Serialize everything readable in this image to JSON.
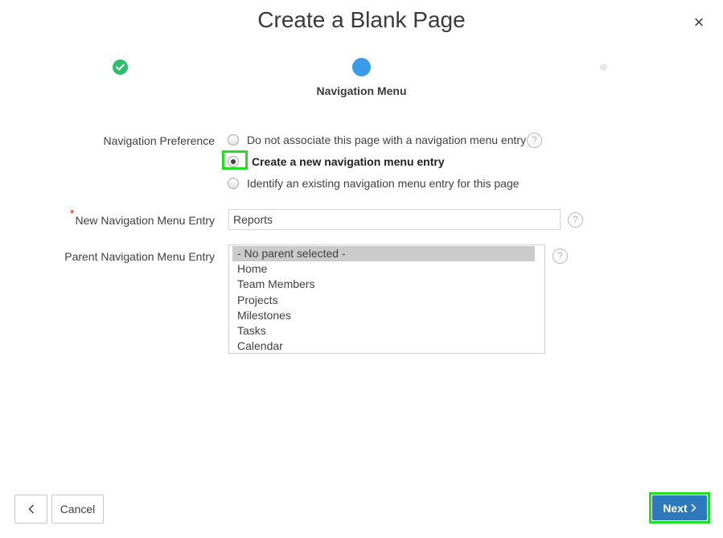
{
  "dialog": {
    "title": "Create a Blank Page",
    "close_glyph": "×"
  },
  "wizard": {
    "current_step_label": "Navigation Menu",
    "steps": [
      "completed",
      "current",
      "upcoming"
    ]
  },
  "form": {
    "navigation_preference": {
      "label": "Navigation Preference",
      "options": [
        {
          "label": "Do not associate this page with a navigation menu entry",
          "selected": false
        },
        {
          "label": "Create a new navigation menu entry",
          "selected": true
        },
        {
          "label": "Identify an existing navigation menu entry for this page",
          "selected": false
        }
      ]
    },
    "new_entry": {
      "required_marker": "*",
      "label": "New Navigation Menu Entry",
      "value": "Reports"
    },
    "parent_entry": {
      "label": "Parent Navigation Menu Entry",
      "options": [
        "- No parent selected -",
        "Home",
        "Team Members",
        "Projects",
        "Milestones",
        "Tasks",
        "Calendar"
      ],
      "selected": "- No parent selected -"
    },
    "help_glyph": "?"
  },
  "footer": {
    "cancel_label": "Cancel",
    "next_label": "Next"
  },
  "colors": {
    "primary": "#2d79bd",
    "step_completed": "#2ebf6d",
    "step_current": "#3a9ce8",
    "focus_highlight": "#22dd22",
    "required": "#e0242b"
  }
}
